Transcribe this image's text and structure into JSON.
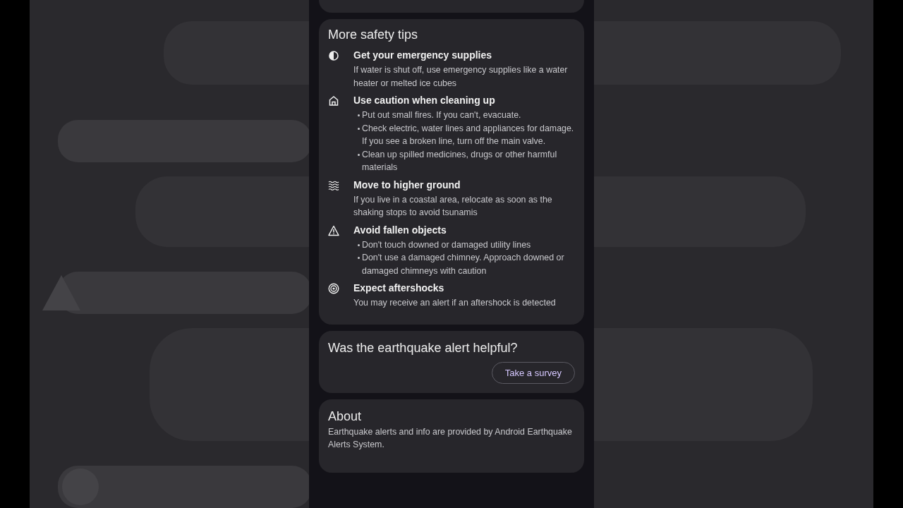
{
  "safety_tips": {
    "title": "More safety tips",
    "tips": [
      {
        "kind": "text",
        "title": "Get your emergency supplies",
        "body": "If water is shut off, use emergency supplies like a water heater or melted ice cubes"
      },
      {
        "kind": "bullets",
        "title": "Use caution when cleaning up",
        "bullets": [
          "Put out small fires. If you can't, evacuate.",
          "Check electric, water lines and appliances for damage. If you see a broken line, turn off the main valve.",
          "Clean up spilled medicines, drugs or other harmful materials"
        ]
      },
      {
        "kind": "text",
        "title": "Move to higher ground",
        "body": "If you live in a coastal area, relocate as soon as the shaking stops to avoid tsunamis"
      },
      {
        "kind": "bullets",
        "title": "Avoid fallen objects",
        "bullets": [
          "Don't touch downed or damaged utility lines",
          "Don't use a damaged chimney. Approach downed or damaged chimneys with caution"
        ]
      },
      {
        "kind": "text",
        "title": "Expect aftershocks",
        "body": "You may receive an alert if an aftershock is detected"
      }
    ]
  },
  "survey": {
    "title": "Was the earthquake alert helpful?",
    "button": "Take a survey"
  },
  "about": {
    "title": "About",
    "body": "Earthquake alerts and info are provided by Android Earthquake Alerts System."
  }
}
